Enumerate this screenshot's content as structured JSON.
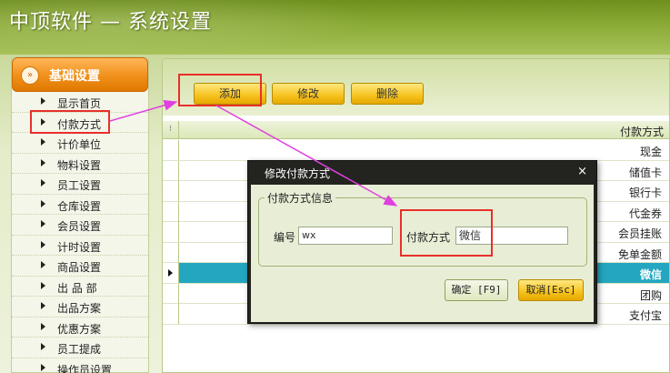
{
  "window": {
    "title": "中顶软件 — 系统设置"
  },
  "sidebar": {
    "header_label": "基础设置",
    "header_icon": "double-chevron-right-icon",
    "items": [
      {
        "label": "显示首页"
      },
      {
        "label": "付款方式"
      },
      {
        "label": "计价单位"
      },
      {
        "label": "物料设置"
      },
      {
        "label": "员工设置"
      },
      {
        "label": "仓库设置"
      },
      {
        "label": "会员设置"
      },
      {
        "label": "计时设置"
      },
      {
        "label": "商品设置"
      },
      {
        "label": "出 品 部"
      },
      {
        "label": "出品方案"
      },
      {
        "label": "优惠方案"
      },
      {
        "label": "员工提成"
      },
      {
        "label": "操作员设置"
      }
    ]
  },
  "toolbar": {
    "add_label": "添加",
    "edit_label": "修改",
    "delete_label": "删除"
  },
  "grid": {
    "corner_label": "⁝",
    "column_title": "付款方式",
    "rows": [
      {
        "value": "现金"
      },
      {
        "value": "储值卡"
      },
      {
        "value": "银行卡"
      },
      {
        "value": "代金券"
      },
      {
        "value": "会员挂账"
      },
      {
        "value": "免单金额"
      },
      {
        "value": "微信",
        "selected": true
      },
      {
        "value": "团购"
      },
      {
        "value": "支付宝"
      }
    ]
  },
  "dialog": {
    "title": "修改付款方式",
    "close_glyph": "×",
    "group_label": "付款方式信息",
    "code_label": "编号",
    "code_value": "wx",
    "method_label": "付款方式",
    "method_value": "微信",
    "ok_label": "确定 [F9]",
    "cancel_label": "取消[Esc]"
  },
  "colors": {
    "header_green": "#8aaa35",
    "accent_orange": "#f0901a",
    "button_yellow": "#f6c21e",
    "selection_teal": "#24a6c0",
    "annotation_red": "#e8302a",
    "annotation_magenta": "#e040e0"
  }
}
